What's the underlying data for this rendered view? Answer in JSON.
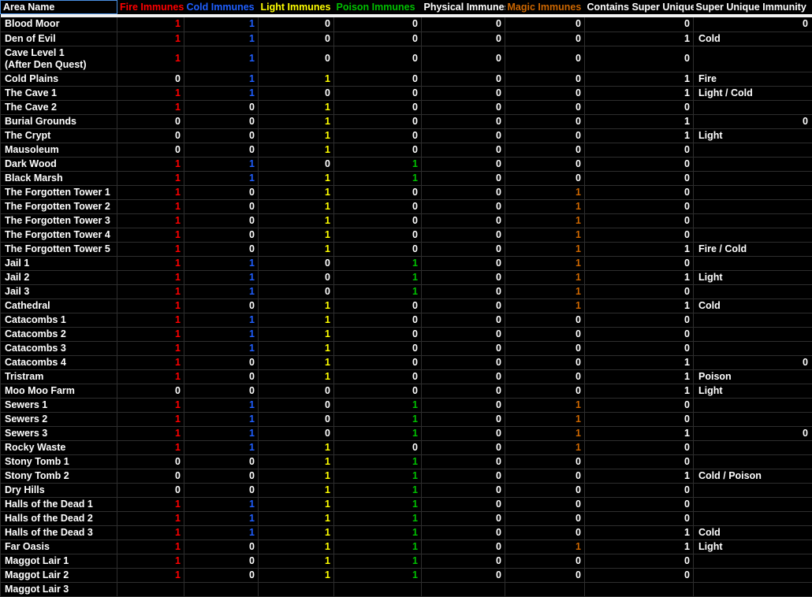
{
  "header": {
    "area_name": "Area Name",
    "columns": [
      {
        "label": "Fire Immunes",
        "key": "fire",
        "color": "#ff0000"
      },
      {
        "label": "Cold Immunes",
        "key": "cold",
        "color": "#1f5fff"
      },
      {
        "label": "Light Immunes",
        "key": "light",
        "color": "#ffff00"
      },
      {
        "label": "Poison Immunes",
        "key": "poison",
        "color": "#00c000"
      },
      {
        "label": "Physical Immunes",
        "key": "phys",
        "color": "#ffffff"
      },
      {
        "label": "Magic Immunes",
        "key": "magic",
        "color": "#cc6600"
      },
      {
        "label": "Contains Super Unique",
        "key": "csu",
        "color": "#ffffff"
      },
      {
        "label": "Super Unique Immunity",
        "key": "sui",
        "color": "#ffffff"
      }
    ]
  },
  "rows": [
    {
      "name": "Blood Moor",
      "fire": "1",
      "cold": "1",
      "light": "0",
      "poison": "0",
      "phys": "0",
      "magic": "0",
      "csu": "0",
      "sui": "0",
      "sui_is_text": false
    },
    {
      "name": "Den of Evil",
      "fire": "1",
      "cold": "1",
      "light": "0",
      "poison": "0",
      "phys": "0",
      "magic": "0",
      "csu": "1",
      "sui": "Cold",
      "sui_is_text": true
    },
    {
      "name": "Cave Level 1",
      "name2": "(After Den Quest)",
      "two_line": true,
      "fire": "1",
      "cold": "1",
      "light": "0",
      "poison": "0",
      "phys": "0",
      "magic": "0",
      "csu": "0",
      "sui": "",
      "sui_is_text": true
    },
    {
      "name": "Cold Plains",
      "fire": "0",
      "cold": "1",
      "light": "1",
      "poison": "0",
      "phys": "0",
      "magic": "0",
      "csu": "1",
      "sui": "Fire",
      "sui_is_text": true
    },
    {
      "name": "The Cave 1",
      "fire": "1",
      "cold": "1",
      "light": "0",
      "poison": "0",
      "phys": "0",
      "magic": "0",
      "csu": "1",
      "sui": "Light / Cold",
      "sui_is_text": true
    },
    {
      "name": "The Cave 2",
      "fire": "1",
      "cold": "0",
      "light": "1",
      "poison": "0",
      "phys": "0",
      "magic": "0",
      "csu": "0",
      "sui": "",
      "sui_is_text": true
    },
    {
      "name": "Burial Grounds",
      "fire": "0",
      "cold": "0",
      "light": "1",
      "poison": "0",
      "phys": "0",
      "magic": "0",
      "csu": "1",
      "sui": "0",
      "sui_is_text": false
    },
    {
      "name": "The Crypt",
      "fire": "0",
      "cold": "0",
      "light": "1",
      "poison": "0",
      "phys": "0",
      "magic": "0",
      "csu": "1",
      "sui": "Light",
      "sui_is_text": true
    },
    {
      "name": "Mausoleum",
      "fire": "0",
      "cold": "0",
      "light": "1",
      "poison": "0",
      "phys": "0",
      "magic": "0",
      "csu": "0",
      "sui": "",
      "sui_is_text": true
    },
    {
      "name": "Dark Wood",
      "fire": "1",
      "cold": "1",
      "light": "0",
      "poison": "1",
      "phys": "0",
      "magic": "0",
      "csu": "0",
      "sui": "",
      "sui_is_text": true
    },
    {
      "name": "Black Marsh",
      "fire": "1",
      "cold": "1",
      "light": "1",
      "poison": "1",
      "phys": "0",
      "magic": "0",
      "csu": "0",
      "sui": "",
      "sui_is_text": true
    },
    {
      "name": "The Forgotten Tower 1",
      "fire": "1",
      "cold": "0",
      "light": "1",
      "poison": "0",
      "phys": "0",
      "magic": "1",
      "csu": "0",
      "sui": "",
      "sui_is_text": true
    },
    {
      "name": "The Forgotten Tower 2",
      "fire": "1",
      "cold": "0",
      "light": "1",
      "poison": "0",
      "phys": "0",
      "magic": "1",
      "csu": "0",
      "sui": "",
      "sui_is_text": true
    },
    {
      "name": "The Forgotten Tower 3",
      "fire": "1",
      "cold": "0",
      "light": "1",
      "poison": "0",
      "phys": "0",
      "magic": "1",
      "csu": "0",
      "sui": "",
      "sui_is_text": true
    },
    {
      "name": "The Forgotten Tower 4",
      "fire": "1",
      "cold": "0",
      "light": "1",
      "poison": "0",
      "phys": "0",
      "magic": "1",
      "csu": "0",
      "sui": "",
      "sui_is_text": true
    },
    {
      "name": "The Forgotten Tower 5",
      "fire": "1",
      "cold": "0",
      "light": "1",
      "poison": "0",
      "phys": "0",
      "magic": "1",
      "csu": "1",
      "sui": "Fire / Cold",
      "sui_is_text": true
    },
    {
      "name": "Jail 1",
      "fire": "1",
      "cold": "1",
      "light": "0",
      "poison": "1",
      "phys": "0",
      "magic": "1",
      "csu": "0",
      "sui": "",
      "sui_is_text": true
    },
    {
      "name": "Jail 2",
      "fire": "1",
      "cold": "1",
      "light": "0",
      "poison": "1",
      "phys": "0",
      "magic": "1",
      "csu": "1",
      "sui": "Light",
      "sui_is_text": true
    },
    {
      "name": "Jail 3",
      "fire": "1",
      "cold": "1",
      "light": "0",
      "poison": "1",
      "phys": "0",
      "magic": "1",
      "csu": "0",
      "sui": "",
      "sui_is_text": true
    },
    {
      "name": "Cathedral",
      "fire": "1",
      "cold": "0",
      "light": "1",
      "poison": "0",
      "phys": "0",
      "magic": "1",
      "csu": "1",
      "sui": "Cold",
      "sui_is_text": true
    },
    {
      "name": "Catacombs 1",
      "fire": "1",
      "cold": "1",
      "light": "1",
      "poison": "0",
      "phys": "0",
      "magic": "0",
      "csu": "0",
      "sui": "",
      "sui_is_text": true
    },
    {
      "name": "Catacombs 2",
      "fire": "1",
      "cold": "1",
      "light": "1",
      "poison": "0",
      "phys": "0",
      "magic": "0",
      "csu": "0",
      "sui": "",
      "sui_is_text": true
    },
    {
      "name": "Catacombs 3",
      "fire": "1",
      "cold": "1",
      "light": "1",
      "poison": "0",
      "phys": "0",
      "magic": "0",
      "csu": "0",
      "sui": "",
      "sui_is_text": true
    },
    {
      "name": "Catacombs 4",
      "fire": "1",
      "cold": "0",
      "light": "1",
      "poison": "0",
      "phys": "0",
      "magic": "0",
      "csu": "1",
      "sui": "0",
      "sui_is_text": false
    },
    {
      "name": "Tristram",
      "fire": "1",
      "cold": "0",
      "light": "1",
      "poison": "0",
      "phys": "0",
      "magic": "0",
      "csu": "1",
      "sui": "Poison",
      "sui_is_text": true
    },
    {
      "name": "Moo Moo Farm",
      "fire": "0",
      "cold": "0",
      "light": "0",
      "poison": "0",
      "phys": "0",
      "magic": "0",
      "csu": "1",
      "sui": "Light",
      "sui_is_text": true
    },
    {
      "name": "Sewers 1",
      "fire": "1",
      "cold": "1",
      "light": "0",
      "poison": "1",
      "phys": "0",
      "magic": "1",
      "csu": "0",
      "sui": "",
      "sui_is_text": true
    },
    {
      "name": "Sewers 2",
      "fire": "1",
      "cold": "1",
      "light": "0",
      "poison": "1",
      "phys": "0",
      "magic": "1",
      "csu": "0",
      "sui": "",
      "sui_is_text": true
    },
    {
      "name": "Sewers 3",
      "fire": "1",
      "cold": "1",
      "light": "0",
      "poison": "1",
      "phys": "0",
      "magic": "1",
      "csu": "1",
      "sui": "0",
      "sui_is_text": false
    },
    {
      "name": "Rocky Waste",
      "fire": "1",
      "cold": "1",
      "light": "1",
      "poison": "0",
      "phys": "0",
      "magic": "1",
      "csu": "0",
      "sui": "",
      "sui_is_text": true
    },
    {
      "name": "Stony Tomb 1",
      "fire": "0",
      "cold": "0",
      "light": "1",
      "poison": "1",
      "phys": "0",
      "magic": "0",
      "csu": "0",
      "sui": "",
      "sui_is_text": true
    },
    {
      "name": "Stony Tomb 2",
      "fire": "0",
      "cold": "0",
      "light": "1",
      "poison": "1",
      "phys": "0",
      "magic": "0",
      "csu": "1",
      "sui": "Cold / Poison",
      "sui_is_text": true
    },
    {
      "name": "Dry Hills",
      "fire": "0",
      "cold": "0",
      "light": "1",
      "poison": "1",
      "phys": "0",
      "magic": "0",
      "csu": "0",
      "sui": "",
      "sui_is_text": true
    },
    {
      "name": "Halls of the Dead 1",
      "fire": "1",
      "cold": "1",
      "light": "1",
      "poison": "1",
      "phys": "0",
      "magic": "0",
      "csu": "0",
      "sui": "",
      "sui_is_text": true
    },
    {
      "name": "Halls of the Dead 2",
      "fire": "1",
      "cold": "1",
      "light": "1",
      "poison": "1",
      "phys": "0",
      "magic": "0",
      "csu": "0",
      "sui": "",
      "sui_is_text": true
    },
    {
      "name": "Halls of the Dead 3",
      "fire": "1",
      "cold": "1",
      "light": "1",
      "poison": "1",
      "phys": "0",
      "magic": "0",
      "csu": "1",
      "sui": "Cold",
      "sui_is_text": true
    },
    {
      "name": "Far Oasis",
      "fire": "1",
      "cold": "0",
      "light": "1",
      "poison": "1",
      "phys": "0",
      "magic": "1",
      "csu": "1",
      "sui": "Light",
      "sui_is_text": true
    },
    {
      "name": "Maggot Lair 1",
      "fire": "1",
      "cold": "0",
      "light": "1",
      "poison": "1",
      "phys": "0",
      "magic": "0",
      "csu": "0",
      "sui": "",
      "sui_is_text": true
    },
    {
      "name": "Maggot Lair 2",
      "fire": "1",
      "cold": "0",
      "light": "1",
      "poison": "1",
      "phys": "0",
      "magic": "0",
      "csu": "0",
      "sui": "",
      "sui_is_text": true
    },
    {
      "name": "Maggot Lair 3",
      "fire": "",
      "cold": "",
      "light": "",
      "poison": "",
      "phys": "",
      "magic": "",
      "csu": "",
      "sui": "",
      "sui_is_text": true,
      "clipped": true
    }
  ]
}
